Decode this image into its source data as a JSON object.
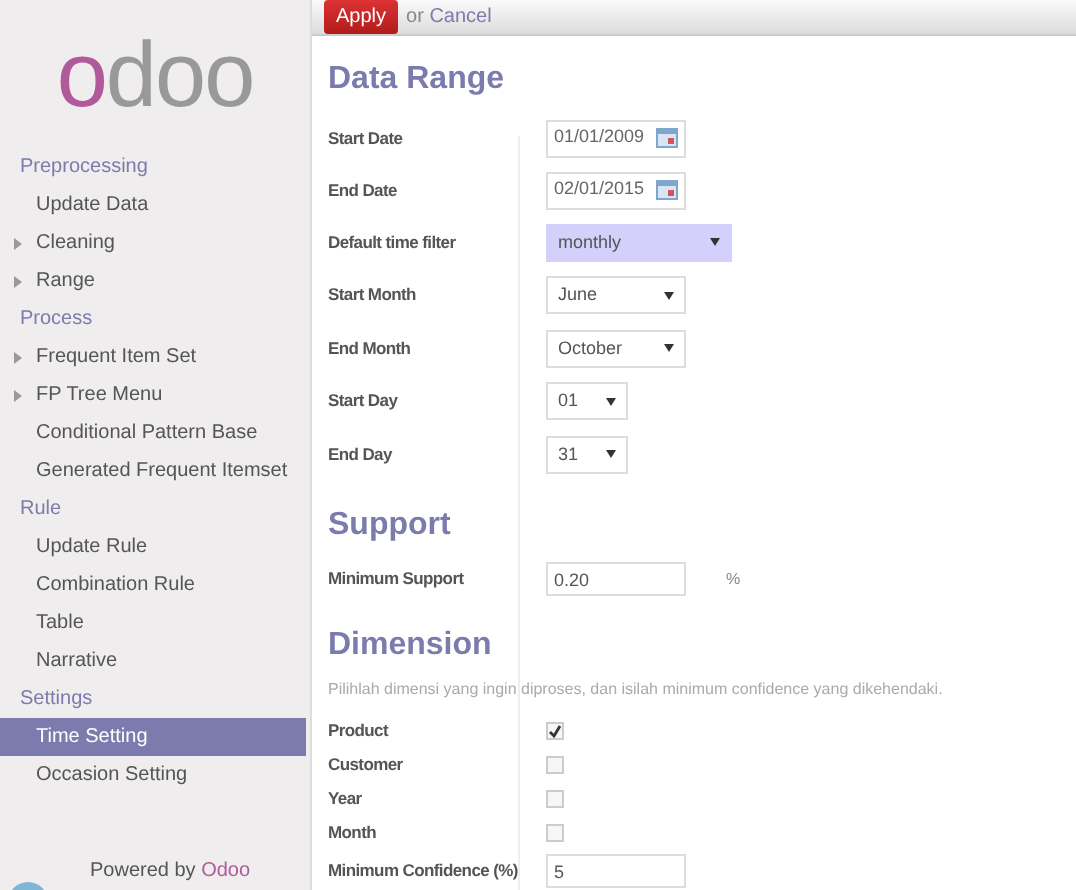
{
  "sidebar": {
    "logo": "odoo",
    "sections": [
      {
        "title": "Preprocessing",
        "items": [
          {
            "label": "Update Data",
            "expandable": false,
            "selected": false
          },
          {
            "label": "Cleaning",
            "expandable": true,
            "selected": false
          },
          {
            "label": "Range",
            "expandable": true,
            "selected": false
          }
        ]
      },
      {
        "title": "Process",
        "items": [
          {
            "label": "Frequent Item Set",
            "expandable": true,
            "selected": false
          },
          {
            "label": "FP Tree Menu",
            "expandable": true,
            "selected": false
          },
          {
            "label": "Conditional Pattern Base",
            "expandable": false,
            "selected": false
          },
          {
            "label": "Generated Frequent Itemset",
            "expandable": false,
            "selected": false
          }
        ]
      },
      {
        "title": "Rule",
        "items": [
          {
            "label": "Update Rule",
            "expandable": false,
            "selected": false
          },
          {
            "label": "Combination Rule",
            "expandable": false,
            "selected": false
          },
          {
            "label": "Table",
            "expandable": false,
            "selected": false
          },
          {
            "label": "Narrative",
            "expandable": false,
            "selected": false
          }
        ]
      },
      {
        "title": "Settings",
        "items": [
          {
            "label": "Time Setting",
            "expandable": false,
            "selected": true
          },
          {
            "label": "Occasion Setting",
            "expandable": false,
            "selected": false
          }
        ]
      }
    ],
    "footer": {
      "prefix": "Powered by",
      "brand": "Odoo"
    }
  },
  "toolbar": {
    "apply": "Apply",
    "or": "or",
    "cancel": "Cancel"
  },
  "sections": [
    {
      "title": "Data Range",
      "fields": [
        {
          "label": "Start Date",
          "kind": "date",
          "value": "01/01/2009"
        },
        {
          "label": "End Date",
          "kind": "date",
          "value": "02/01/2015"
        },
        {
          "label": "Default time filter",
          "kind": "select",
          "value": "monthly",
          "required": true
        },
        {
          "label": "Start Month",
          "kind": "select",
          "value": "June",
          "required": false
        },
        {
          "label": "End Month",
          "kind": "select",
          "value": "October",
          "required": false
        },
        {
          "label": "Start Day",
          "kind": "select",
          "value": "01",
          "required": false
        },
        {
          "label": "End Day",
          "kind": "select",
          "value": "31",
          "required": false
        }
      ]
    },
    {
      "title": "Support",
      "fields": [
        {
          "label": "Minimum Support",
          "kind": "text",
          "value": "0.20",
          "unit": "%"
        }
      ]
    },
    {
      "title": "Dimension",
      "description": "Pilihlah dimensi yang ingin diproses, dan isilah minimum confidence yang dikehendaki.",
      "fields": [
        {
          "label": "Product",
          "kind": "checkbox",
          "checked": true
        },
        {
          "label": "Customer",
          "kind": "checkbox",
          "checked": false
        },
        {
          "label": "Year",
          "kind": "checkbox",
          "checked": false
        },
        {
          "label": "Month",
          "kind": "checkbox",
          "checked": false
        },
        {
          "label": "Minimum Confidence (%)",
          "kind": "text",
          "value": "5"
        }
      ]
    }
  ]
}
